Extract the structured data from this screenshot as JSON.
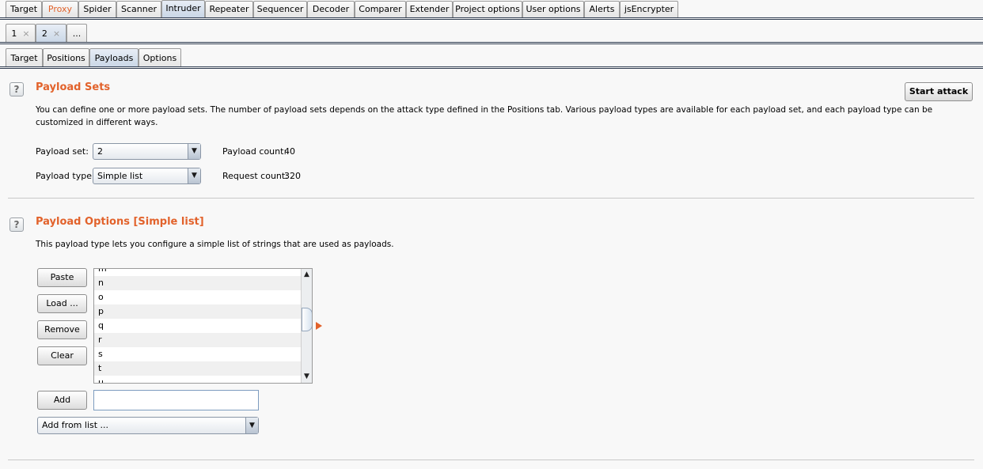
{
  "main_tabs": [
    {
      "label": "Target"
    },
    {
      "label": "Proxy",
      "color": "#e2622b"
    },
    {
      "label": "Spider"
    },
    {
      "label": "Scanner"
    },
    {
      "label": "Intruder",
      "active": true
    },
    {
      "label": "Repeater"
    },
    {
      "label": "Sequencer"
    },
    {
      "label": "Decoder"
    },
    {
      "label": "Comparer"
    },
    {
      "label": "Extender"
    },
    {
      "label": "Project options"
    },
    {
      "label": "User options"
    },
    {
      "label": "Alerts"
    },
    {
      "label": "jsEncrypter"
    }
  ],
  "attack_tabs": [
    {
      "label": "1",
      "close": "×"
    },
    {
      "label": "2",
      "close": "×",
      "active": true
    },
    {
      "label": "..."
    }
  ],
  "sub_tabs": [
    {
      "label": "Target"
    },
    {
      "label": "Positions"
    },
    {
      "label": "Payloads",
      "active": true
    },
    {
      "label": "Options"
    }
  ],
  "payload_sets": {
    "title": "Payload Sets",
    "description_line1": "You can define one or more payload sets. The number of payload sets depends on the attack type defined in the Positions tab. Various payload types are available for each payload set, and each payload type can be",
    "description_line2": "customized in different ways.",
    "set_label": "Payload set:",
    "set_value": "2",
    "type_label": "Payload type:",
    "type_value": "Simple list",
    "count_label": "Payload count:",
    "count_value": "40",
    "request_label": "Request count:",
    "request_value": "320",
    "start_button": "Start attack",
    "help": "?"
  },
  "payload_options": {
    "title": "Payload Options [Simple list]",
    "description": "This payload type lets you configure a simple list of strings that are used as payloads.",
    "help": "?",
    "buttons": {
      "paste": "Paste",
      "load": "Load ...",
      "remove": "Remove",
      "clear": "Clear",
      "add": "Add"
    },
    "list_items": [
      "m",
      "n",
      "o",
      "p",
      "q",
      "r",
      "s",
      "t",
      "u"
    ],
    "add_input_value": "",
    "add_from_list": "Add from list ..."
  },
  "colors": {
    "accent": "#e2622b",
    "tab_active": "#c9d6e6"
  }
}
